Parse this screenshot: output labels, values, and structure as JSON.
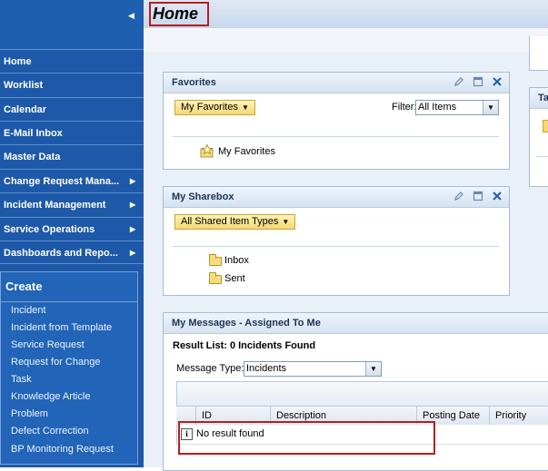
{
  "header": {
    "title": "Home"
  },
  "nav": {
    "items": [
      {
        "label": "Home",
        "has_arrow": false
      },
      {
        "label": "Worklist",
        "has_arrow": false
      },
      {
        "label": "Calendar",
        "has_arrow": false
      },
      {
        "label": "E-Mail Inbox",
        "has_arrow": false
      },
      {
        "label": "Master Data",
        "has_arrow": false
      },
      {
        "label": "Change Request Mana...",
        "has_arrow": true
      },
      {
        "label": "Incident Management",
        "has_arrow": true
      },
      {
        "label": "Service Operations",
        "has_arrow": true
      },
      {
        "label": "Dashboards and Repo...",
        "has_arrow": true
      }
    ],
    "create": {
      "title": "Create",
      "links": [
        "Incident",
        "Incident from Template",
        "Service Request",
        "Request for Change",
        "Task",
        "Knowledge Article",
        "Problem",
        "Defect Correction",
        "BP Monitoring Request"
      ]
    }
  },
  "favorites": {
    "title": "Favorites",
    "button": "My Favorites",
    "filter_label": "Filter:",
    "filter_value": "All Items",
    "item": "My Favorites"
  },
  "sharebox": {
    "title": "My Sharebox",
    "button": "All Shared Item Types",
    "folders": [
      "Inbox",
      "Sent"
    ]
  },
  "messages": {
    "title": "My Messages - Assigned To Me",
    "result": "Result List: 0 Incidents Found",
    "type_label": "Message Type:",
    "type_value": "Incidents",
    "columns": [
      "ID",
      "Description",
      "Posting Date",
      "Priority"
    ],
    "empty": "No result found"
  },
  "right_panel": {
    "title": "Ta"
  },
  "colors": {
    "nav_bg": "#1d59a8",
    "highlight": "#b61f1f",
    "button": "#f6d774"
  }
}
